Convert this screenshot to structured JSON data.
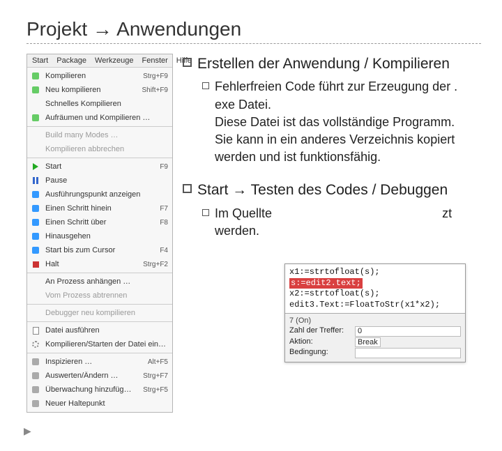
{
  "title": "Projekt → Anwendungen",
  "menubar": [
    "Start",
    "Package",
    "Werkzeuge",
    "Fenster",
    "Hilfe"
  ],
  "menu": [
    {
      "icon": "ic-green",
      "label": "Kompilieren",
      "short": "Strg+F9"
    },
    {
      "icon": "ic-green",
      "label": "Neu kompilieren",
      "short": "Shift+F9"
    },
    {
      "icon": "",
      "label": "Schnelles Kompilieren",
      "short": ""
    },
    {
      "icon": "ic-green",
      "label": "Aufräumen und Kompilieren …",
      "short": ""
    },
    {
      "sep": true
    },
    {
      "icon": "",
      "label": "Build many Modes …",
      "short": "",
      "disabled": true
    },
    {
      "icon": "",
      "label": "Kompilieren abbrechen",
      "short": "",
      "disabled": true
    },
    {
      "sep": true
    },
    {
      "icon": "ic-play",
      "label": "Start",
      "short": "F9"
    },
    {
      "icon": "ic-pause",
      "label": "Pause",
      "short": ""
    },
    {
      "icon": "ic-blue",
      "label": "Ausführungspunkt anzeigen",
      "short": ""
    },
    {
      "icon": "ic-blue",
      "label": "Einen Schritt hinein",
      "short": "F7"
    },
    {
      "icon": "ic-blue",
      "label": "Einen Schritt über",
      "short": "F8"
    },
    {
      "icon": "ic-blue",
      "label": "Hinausgehen",
      "short": ""
    },
    {
      "icon": "ic-blue",
      "label": "Start bis zum Cursor",
      "short": "F4"
    },
    {
      "icon": "ic-stop",
      "label": "Halt",
      "short": "Strg+F2"
    },
    {
      "sep": true
    },
    {
      "icon": "",
      "label": "An Prozess anhängen …",
      "short": ""
    },
    {
      "icon": "",
      "label": "Vom Prozess abtrennen",
      "short": "",
      "disabled": true
    },
    {
      "sep": true
    },
    {
      "icon": "",
      "label": "Debugger neu kompilieren",
      "short": "",
      "disabled": true
    },
    {
      "sep": true
    },
    {
      "icon": "ic-doc",
      "label": "Datei ausführen",
      "short": ""
    },
    {
      "icon": "ic-gear",
      "label": "Kompilieren/Starten der Datei einrichten …",
      "short": ""
    },
    {
      "sep": true
    },
    {
      "icon": "ic-gray",
      "label": "Inspizieren …",
      "short": "Alt+F5"
    },
    {
      "icon": "ic-gray",
      "label": "Auswerten/Ändern …",
      "short": "Strg+F7"
    },
    {
      "icon": "ic-gray",
      "label": "Überwachung hinzufügen …",
      "short": "Strg+F5"
    },
    {
      "icon": "ic-gray",
      "label": "Neuer Haltepunkt",
      "short": ""
    }
  ],
  "bullets": {
    "b1_main": "Erstellen der Anwendung / Kompilieren",
    "b1_sub": "Fehlerfreien Code führt zur Erzeugung der . exe Datei.\nDiese Datei ist das vollständige Programm.\nSie kann in ein anderes Verzeichnis kopiert werden und ist funktionsfähig.",
    "b2_main": "Start → Testen des Codes / Debuggen",
    "b2_sub_pre": "Im Quellte",
    "b2_sub_post": "zt werden."
  },
  "overlay": {
    "code_lines": [
      "x1:=strtofloat(s);",
      "s:=edit2.text;",
      "x2:=strtofloat(s);",
      "edit3.Text:=FloatToStr(x1*x2);"
    ],
    "tab": "7 (On)",
    "rows": [
      {
        "k": "Zahl der Treffer:",
        "v": "0"
      },
      {
        "k": "Aktion:",
        "v": "Break",
        "select": true
      },
      {
        "k": "Bedingung:",
        "v": ""
      }
    ]
  }
}
